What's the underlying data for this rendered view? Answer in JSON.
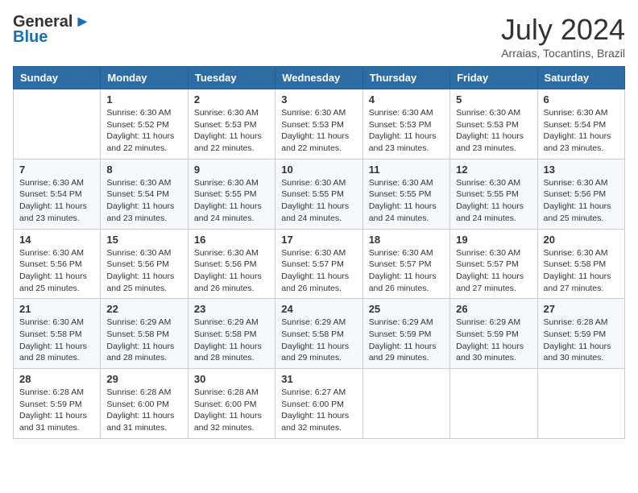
{
  "header": {
    "logo_general": "General",
    "logo_blue": "Blue",
    "month_year": "July 2024",
    "location": "Arraias, Tocantins, Brazil"
  },
  "columns": [
    "Sunday",
    "Monday",
    "Tuesday",
    "Wednesday",
    "Thursday",
    "Friday",
    "Saturday"
  ],
  "weeks": [
    [
      {
        "day": "",
        "info": ""
      },
      {
        "day": "1",
        "info": "Sunrise: 6:30 AM\nSunset: 5:52 PM\nDaylight: 11 hours\nand 22 minutes."
      },
      {
        "day": "2",
        "info": "Sunrise: 6:30 AM\nSunset: 5:53 PM\nDaylight: 11 hours\nand 22 minutes."
      },
      {
        "day": "3",
        "info": "Sunrise: 6:30 AM\nSunset: 5:53 PM\nDaylight: 11 hours\nand 22 minutes."
      },
      {
        "day": "4",
        "info": "Sunrise: 6:30 AM\nSunset: 5:53 PM\nDaylight: 11 hours\nand 23 minutes."
      },
      {
        "day": "5",
        "info": "Sunrise: 6:30 AM\nSunset: 5:53 PM\nDaylight: 11 hours\nand 23 minutes."
      },
      {
        "day": "6",
        "info": "Sunrise: 6:30 AM\nSunset: 5:54 PM\nDaylight: 11 hours\nand 23 minutes."
      }
    ],
    [
      {
        "day": "7",
        "info": "Sunrise: 6:30 AM\nSunset: 5:54 PM\nDaylight: 11 hours\nand 23 minutes."
      },
      {
        "day": "8",
        "info": "Sunrise: 6:30 AM\nSunset: 5:54 PM\nDaylight: 11 hours\nand 23 minutes."
      },
      {
        "day": "9",
        "info": "Sunrise: 6:30 AM\nSunset: 5:55 PM\nDaylight: 11 hours\nand 24 minutes."
      },
      {
        "day": "10",
        "info": "Sunrise: 6:30 AM\nSunset: 5:55 PM\nDaylight: 11 hours\nand 24 minutes."
      },
      {
        "day": "11",
        "info": "Sunrise: 6:30 AM\nSunset: 5:55 PM\nDaylight: 11 hours\nand 24 minutes."
      },
      {
        "day": "12",
        "info": "Sunrise: 6:30 AM\nSunset: 5:55 PM\nDaylight: 11 hours\nand 24 minutes."
      },
      {
        "day": "13",
        "info": "Sunrise: 6:30 AM\nSunset: 5:56 PM\nDaylight: 11 hours\nand 25 minutes."
      }
    ],
    [
      {
        "day": "14",
        "info": "Sunrise: 6:30 AM\nSunset: 5:56 PM\nDaylight: 11 hours\nand 25 minutes."
      },
      {
        "day": "15",
        "info": "Sunrise: 6:30 AM\nSunset: 5:56 PM\nDaylight: 11 hours\nand 25 minutes."
      },
      {
        "day": "16",
        "info": "Sunrise: 6:30 AM\nSunset: 5:56 PM\nDaylight: 11 hours\nand 26 minutes."
      },
      {
        "day": "17",
        "info": "Sunrise: 6:30 AM\nSunset: 5:57 PM\nDaylight: 11 hours\nand 26 minutes."
      },
      {
        "day": "18",
        "info": "Sunrise: 6:30 AM\nSunset: 5:57 PM\nDaylight: 11 hours\nand 26 minutes."
      },
      {
        "day": "19",
        "info": "Sunrise: 6:30 AM\nSunset: 5:57 PM\nDaylight: 11 hours\nand 27 minutes."
      },
      {
        "day": "20",
        "info": "Sunrise: 6:30 AM\nSunset: 5:58 PM\nDaylight: 11 hours\nand 27 minutes."
      }
    ],
    [
      {
        "day": "21",
        "info": "Sunrise: 6:30 AM\nSunset: 5:58 PM\nDaylight: 11 hours\nand 28 minutes."
      },
      {
        "day": "22",
        "info": "Sunrise: 6:29 AM\nSunset: 5:58 PM\nDaylight: 11 hours\nand 28 minutes."
      },
      {
        "day": "23",
        "info": "Sunrise: 6:29 AM\nSunset: 5:58 PM\nDaylight: 11 hours\nand 28 minutes."
      },
      {
        "day": "24",
        "info": "Sunrise: 6:29 AM\nSunset: 5:58 PM\nDaylight: 11 hours\nand 29 minutes."
      },
      {
        "day": "25",
        "info": "Sunrise: 6:29 AM\nSunset: 5:59 PM\nDaylight: 11 hours\nand 29 minutes."
      },
      {
        "day": "26",
        "info": "Sunrise: 6:29 AM\nSunset: 5:59 PM\nDaylight: 11 hours\nand 30 minutes."
      },
      {
        "day": "27",
        "info": "Sunrise: 6:28 AM\nSunset: 5:59 PM\nDaylight: 11 hours\nand 30 minutes."
      }
    ],
    [
      {
        "day": "28",
        "info": "Sunrise: 6:28 AM\nSunset: 5:59 PM\nDaylight: 11 hours\nand 31 minutes."
      },
      {
        "day": "29",
        "info": "Sunrise: 6:28 AM\nSunset: 6:00 PM\nDaylight: 11 hours\nand 31 minutes."
      },
      {
        "day": "30",
        "info": "Sunrise: 6:28 AM\nSunset: 6:00 PM\nDaylight: 11 hours\nand 32 minutes."
      },
      {
        "day": "31",
        "info": "Sunrise: 6:27 AM\nSunset: 6:00 PM\nDaylight: 11 hours\nand 32 minutes."
      },
      {
        "day": "",
        "info": ""
      },
      {
        "day": "",
        "info": ""
      },
      {
        "day": "",
        "info": ""
      }
    ]
  ]
}
